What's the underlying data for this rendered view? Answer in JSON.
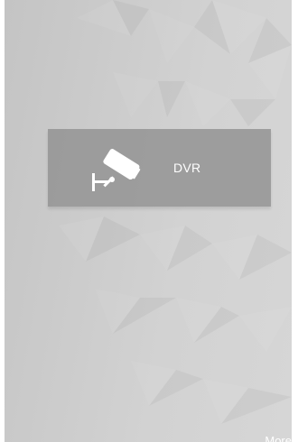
{
  "menu": {
    "items": [
      {
        "label": "DVR",
        "icon": "cctv-camera-icon"
      }
    ]
  },
  "footer": {
    "more_label": "More"
  },
  "colors": {
    "card_background": "#919191",
    "text": "#ffffff"
  }
}
